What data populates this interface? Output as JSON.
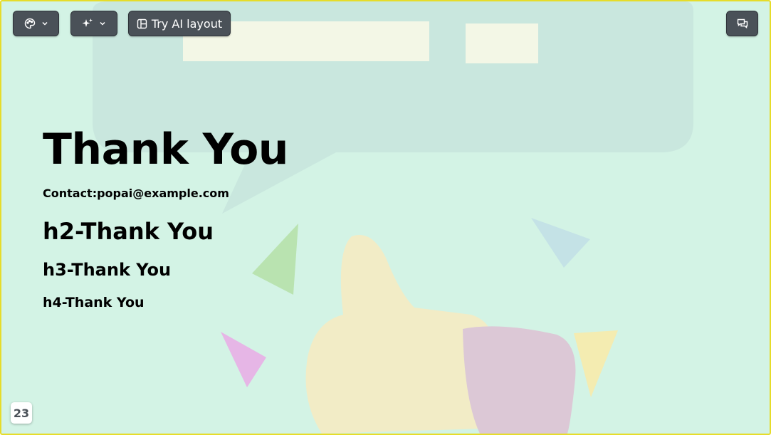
{
  "toolbar": {
    "theme_icon": "palette-icon",
    "ai_icon": "sparkles-icon",
    "layout_icon": "layout-icon",
    "layout_label": "Try AI layout",
    "comment_icon": "comments-icon"
  },
  "slide": {
    "title": "Thank You",
    "contact": "Contact:popai@example.com",
    "h2": "h2-Thank You",
    "h3": "h3-Thank You",
    "h4": "h4-Thank You",
    "page_number": "23",
    "background_image": "thumbs-up-with-speech-bubble-illustration"
  },
  "colors": {
    "background": "#d3f3e5",
    "border": "#e6dc2a",
    "button": "#4a5158"
  }
}
